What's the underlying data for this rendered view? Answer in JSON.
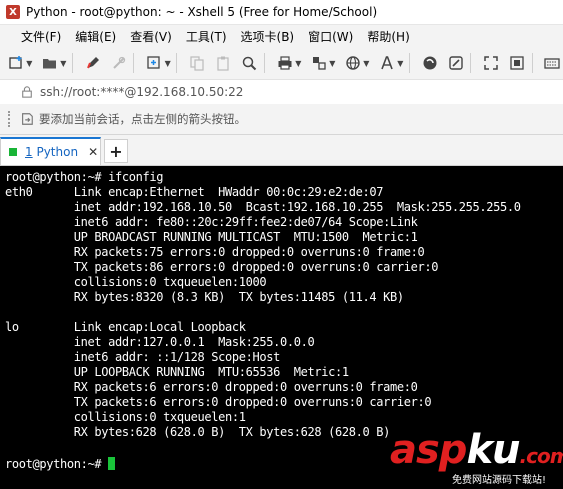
{
  "window": {
    "title": "Python - root@python: ~ - Xshell 5 (Free for Home/School)",
    "app_icon_glyph": "X"
  },
  "menu": [
    "文件(F)",
    "编辑(E)",
    "查看(V)",
    "工具(T)",
    "选项卡(B)",
    "窗口(W)",
    "帮助(H)"
  ],
  "toolbar_icons": [
    "new-session-icon",
    "open-folder-icon",
    "properties-pen-icon",
    "disconnect-icon",
    "new-tab-icon",
    "copy-icon",
    "paste-icon",
    "find-icon",
    "print-icon",
    "transfer-icon",
    "globe-icon",
    "font-icon",
    "xftp-icon",
    "keymap-icon",
    "fullscreen-icon",
    "lock-screen-icon",
    "keyboard-icon"
  ],
  "address": {
    "text": "ssh://root:****@192.168.10.50:22"
  },
  "hint": {
    "text": "要添加当前会话，点击左侧的箭头按钮。"
  },
  "tabs": [
    {
      "number": "1",
      "label": "Python",
      "active": true,
      "close": "✕"
    }
  ],
  "tab_add": "+",
  "terminal": {
    "lines": [
      "root@python:~# ifconfig",
      "eth0      Link encap:Ethernet  HWaddr 00:0c:29:e2:de:07  ",
      "          inet addr:192.168.10.50  Bcast:192.168.10.255  Mask:255.255.255.0",
      "          inet6 addr: fe80::20c:29ff:fee2:de07/64 Scope:Link",
      "          UP BROADCAST RUNNING MULTICAST  MTU:1500  Metric:1",
      "          RX packets:75 errors:0 dropped:0 overruns:0 frame:0",
      "          TX packets:86 errors:0 dropped:0 overruns:0 carrier:0",
      "          collisions:0 txqueuelen:1000 ",
      "          RX bytes:8320 (8.3 KB)  TX bytes:11485 (11.4 KB)",
      "",
      "lo        Link encap:Local Loopback  ",
      "          inet addr:127.0.0.1  Mask:255.0.0.0",
      "          inet6 addr: ::1/128 Scope:Host",
      "          UP LOOPBACK RUNNING  MTU:65536  Metric:1",
      "          RX packets:6 errors:0 dropped:0 overruns:0 frame:0",
      "          TX packets:6 errors:0 dropped:0 overruns:0 carrier:0",
      "          collisions:0 txqueuelen:1 ",
      "          RX bytes:628 (628.0 B)  TX bytes:628 (628.0 B)",
      "",
      "root@python:~# "
    ],
    "cursor_color": "#19c43a"
  },
  "watermark": {
    "logo_asp": "asp",
    "logo_ku": "ku",
    "logo_tld": ".com",
    "subtitle": "免费网站源码下载站!"
  },
  "colors": {
    "accent": "#1976d2",
    "terminal_bg": "#000000",
    "terminal_fg": "#ffffff",
    "tab_status": "#19b437"
  }
}
